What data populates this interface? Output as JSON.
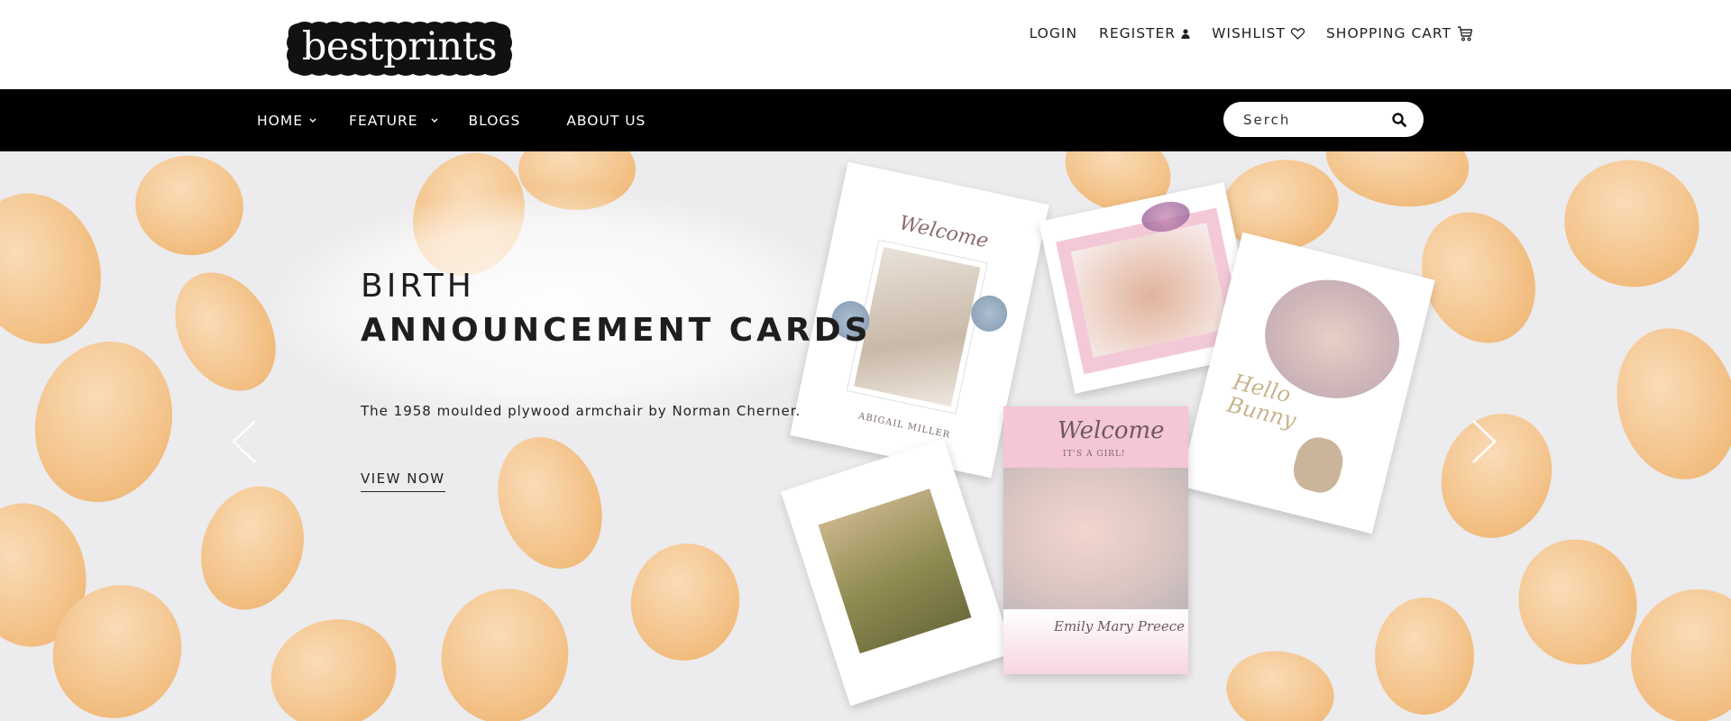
{
  "brand": {
    "logo_text": "bestprints"
  },
  "user_nav": {
    "login": "LOGIN",
    "register": "REGISTER",
    "wishlist": "WISHLIST",
    "cart": "SHOPPING CART"
  },
  "main_nav": {
    "items": [
      {
        "label": "HOME",
        "has_dropdown": true
      },
      {
        "label": "FEATURE",
        "has_dropdown": true
      },
      {
        "label": "BLOGS",
        "has_dropdown": false
      },
      {
        "label": "ABOUT US",
        "has_dropdown": false
      }
    ]
  },
  "search": {
    "placeholder": "Serch"
  },
  "hero": {
    "title_line1": "BIRTH",
    "title_line2": "ANNOUNCEMENT CARDS",
    "subtitle": "The 1958 moulded plywood armchair by Norman Cherner.",
    "cta": "VIEW NOW"
  },
  "cards": {
    "card1_script": "Welcome",
    "card1_name": "ABIGAIL MILLER",
    "card4_script": "Welcome",
    "card4_sub": "IT'S A GIRL!",
    "card4_name": "Emily Mary Preece",
    "card3_script": "Hello Bunny"
  },
  "colors": {
    "header_bg": "#ffffff",
    "nav_bg": "#000000",
    "hero_bg": "#ecebed",
    "petal": "#f6c58c",
    "card_pink": "#f4c6d6"
  },
  "icons": {
    "register": "user-icon",
    "wishlist": "heart-icon",
    "cart": "cart-icon",
    "search": "search-icon",
    "dropdown": "chevron-down-icon",
    "prev": "chevron-left-icon",
    "next": "chevron-right-icon"
  }
}
